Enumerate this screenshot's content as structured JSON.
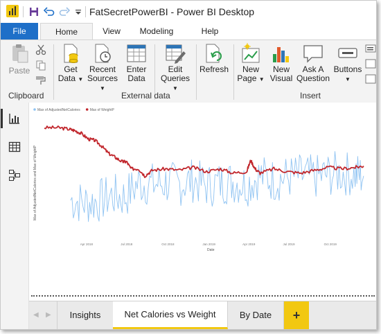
{
  "window": {
    "title": "FatSecretPowerBI - Power BI Desktop",
    "quick_access": [
      "save-icon",
      "undo-icon",
      "redo-icon",
      "customize-caret"
    ]
  },
  "tabs": [
    {
      "label": "File"
    },
    {
      "label": "Home"
    },
    {
      "label": "View"
    },
    {
      "label": "Modeling"
    },
    {
      "label": "Help"
    }
  ],
  "ribbon": {
    "clipboard": {
      "paste": "Paste",
      "group": "Clipboard"
    },
    "external": {
      "get_data_1": "Get",
      "get_data_2": "Data",
      "recent_1": "Recent",
      "recent_2": "Sources",
      "enter_1": "Enter",
      "enter_2": "Data",
      "edit_1": "Edit",
      "edit_2": "Queries",
      "refresh": "Refresh",
      "group": "External data"
    },
    "insert": {
      "newpage_1": "New",
      "newpage_2": "Page",
      "newvisual_1": "New",
      "newvisual_2": "Visual",
      "ask_1": "Ask A",
      "ask_2": "Question",
      "buttons": "Buttons",
      "group": "Insert"
    }
  },
  "pages": {
    "tabs": [
      "Insights",
      "Net Calories vs Weight",
      "By Date"
    ],
    "add": "+"
  },
  "chart_data": {
    "type": "line",
    "legend": [
      "Max of AdjustedNetCalories",
      "Max of WeightP"
    ],
    "legend_position": "top-left",
    "colors": {
      "calories": "#8fc3f2",
      "weight": "#c1272d"
    },
    "xlabel": "Date",
    "ylabel": "Max of AdjustedNetCalories and Max of WeightP",
    "x_ticks": [
      "Apr 2018",
      "Jul 2018",
      "Oct 2018",
      "Jan 2019",
      "Apr 2019",
      "Jul 2019",
      "Oct 2019"
    ],
    "x_range": [
      "2018-01-01",
      "2019-12-31"
    ],
    "grid": false,
    "series": [
      {
        "name": "Max of WeightP",
        "x": [
          "2018-01-01",
          "2018-02-01",
          "2018-02-25",
          "2018-03-10",
          "2018-03-25",
          "2018-04-10",
          "2018-04-25",
          "2018-05-10",
          "2018-05-25",
          "2018-06-10",
          "2018-06-25",
          "2018-07-05",
          "2018-07-15",
          "2018-08-01",
          "2018-08-15",
          "2018-09-01",
          "2018-10-01",
          "2018-11-01",
          "2018-12-01",
          "2019-01-01",
          "2019-02-01",
          "2019-03-01",
          "2019-04-01",
          "2019-04-10",
          "2019-04-20",
          "2019-05-01",
          "2019-06-01",
          "2019-07-01",
          "2019-08-01",
          "2019-09-01",
          "2019-10-01",
          "2019-11-01",
          "2019-12-01",
          "2019-12-20"
        ],
        "values": [
          4.0,
          4.0,
          3.95,
          3.9,
          3.8,
          3.6,
          3.55,
          3.35,
          3.1,
          2.95,
          2.8,
          2.8,
          2.55,
          2.55,
          2.3,
          2.5,
          2.55,
          2.5,
          2.6,
          2.45,
          2.55,
          2.4,
          2.45,
          2.85,
          2.55,
          2.4,
          2.55,
          2.45,
          2.4,
          2.5,
          2.6,
          2.55,
          2.6,
          2.65
        ]
      },
      {
        "name": "Max of AdjustedNetCalories",
        "x": [
          "2018-03-01",
          "2018-04-01",
          "2018-05-01",
          "2018-06-01",
          "2018-07-01",
          "2018-08-01",
          "2018-09-01",
          "2018-10-01",
          "2018-11-01",
          "2018-12-01",
          "2019-01-01",
          "2019-02-01",
          "2019-03-01",
          "2019-04-01",
          "2019-05-01",
          "2019-06-01",
          "2019-07-01",
          "2019-08-01",
          "2019-09-01",
          "2019-10-01",
          "2019-11-01",
          "2019-12-01",
          "2019-12-20"
        ],
        "values": [
          1.45,
          1.35,
          1.4,
          1.6,
          1.55,
          2.05,
          2.0,
          2.05,
          2.0,
          2.15,
          1.95,
          2.05,
          2.1,
          2.0,
          2.3,
          2.15,
          2.25,
          2.3,
          2.25,
          2.35,
          2.4,
          2.35,
          2.3
        ]
      }
    ]
  }
}
